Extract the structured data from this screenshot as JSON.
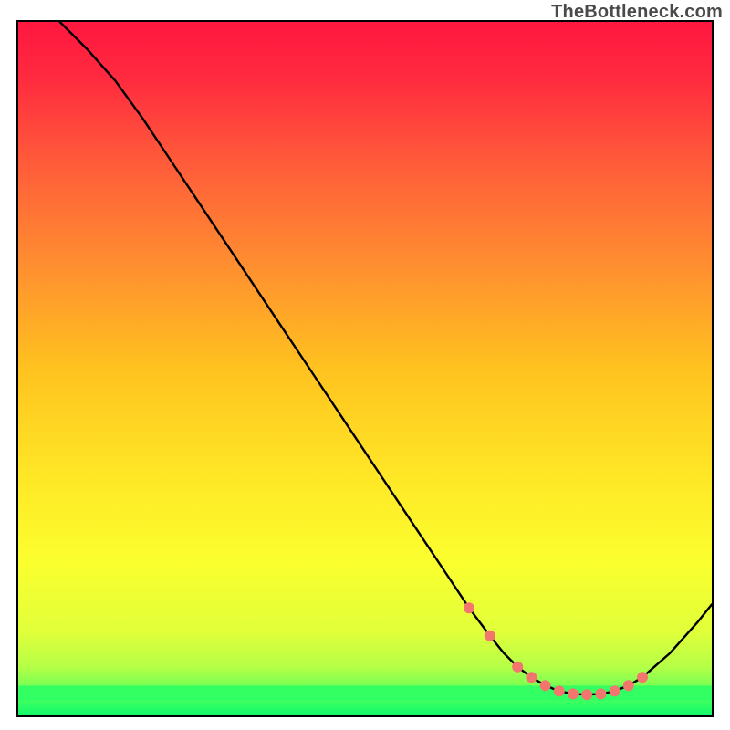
{
  "watermark": "TheBottleneck.com",
  "chart_data": {
    "type": "line",
    "title": "",
    "xlabel": "",
    "ylabel": "",
    "xlim": [
      0,
      100
    ],
    "ylim": [
      0,
      100
    ],
    "series": [
      {
        "name": "bottleneck-curve",
        "x": [
          6,
          10,
          14,
          18,
          22,
          26,
          30,
          34,
          38,
          42,
          46,
          50,
          54,
          58,
          62,
          65,
          68,
          70,
          72,
          74,
          76,
          78,
          80,
          82,
          84,
          86,
          88,
          90,
          94,
          98,
          100
        ],
        "y": [
          100,
          96,
          91.5,
          86,
          80,
          74,
          68,
          62,
          56,
          50,
          44,
          38,
          32,
          26,
          20,
          15.5,
          11.5,
          9,
          7,
          5.5,
          4.3,
          3.5,
          3.1,
          3.0,
          3.1,
          3.5,
          4.3,
          5.5,
          9,
          13.5,
          16
        ]
      }
    ],
    "markers": {
      "name": "highlight-dots",
      "x": [
        65,
        68,
        72,
        74,
        76,
        78,
        80,
        82,
        84,
        86,
        88,
        90
      ],
      "y": [
        15.5,
        11.5,
        7,
        5.5,
        4.3,
        3.5,
        3.1,
        3.0,
        3.1,
        3.5,
        4.3,
        5.5
      ],
      "color": "#f2766d",
      "radius_px": 6
    },
    "band": {
      "y": 3.5,
      "color": "#2dff64"
    },
    "background": {
      "type": "vertical-gradient",
      "stops": [
        {
          "offset": 0.0,
          "color": "#ff173f"
        },
        {
          "offset": 0.08,
          "color": "#ff2a3f"
        },
        {
          "offset": 0.2,
          "color": "#ff5a3a"
        },
        {
          "offset": 0.35,
          "color": "#ff8e30"
        },
        {
          "offset": 0.5,
          "color": "#ffc21f"
        },
        {
          "offset": 0.65,
          "color": "#ffe626"
        },
        {
          "offset": 0.78,
          "color": "#fbff2e"
        },
        {
          "offset": 0.88,
          "color": "#e0ff3a"
        },
        {
          "offset": 0.93,
          "color": "#b5ff47"
        },
        {
          "offset": 0.965,
          "color": "#6aff55"
        },
        {
          "offset": 0.985,
          "color": "#2dff64"
        },
        {
          "offset": 1.0,
          "color": "#13f86a"
        }
      ]
    }
  }
}
